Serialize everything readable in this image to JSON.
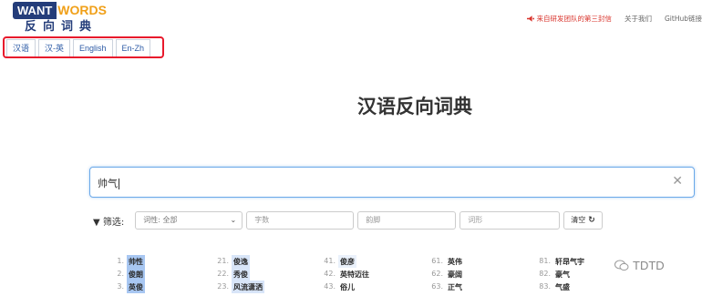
{
  "header": {
    "logo_want": "WANT",
    "logo_words": "WORDS",
    "logo_sub": "反向词典",
    "links": [
      {
        "label": "来自研发团队的第三封信",
        "icon": "megaphone-icon",
        "color": "#d9332b"
      },
      {
        "label": "关于我们"
      },
      {
        "label": "GitHub链接"
      }
    ]
  },
  "tabs": [
    {
      "label": "汉语",
      "active": true
    },
    {
      "label": "汉-英"
    },
    {
      "label": "English"
    },
    {
      "label": "En-Zh"
    }
  ],
  "page_title": "汉语反向词典",
  "search": {
    "value": "帅气",
    "clear_icon": "close-icon"
  },
  "filter": {
    "label": "▼ 筛选:",
    "pos_select": "词性: 全部",
    "char_count_placeholder": "字数",
    "rhyme_placeholder": "韵脚",
    "form_placeholder": "词形",
    "clear_label": "清空",
    "clear_icon": "refresh-icon"
  },
  "results": [
    [
      {
        "n": "1.",
        "w": "帅性"
      },
      {
        "n": "2.",
        "w": "俊朗"
      },
      {
        "n": "3.",
        "w": "英俊"
      }
    ],
    [
      {
        "n": "21.",
        "w": "俊逸"
      },
      {
        "n": "22.",
        "w": "秀俊"
      },
      {
        "n": "23.",
        "w": "风流潇洒"
      }
    ],
    [
      {
        "n": "41.",
        "w": "俊彦"
      },
      {
        "n": "42.",
        "w": "英特迈往"
      },
      {
        "n": "43.",
        "w": "俗儿"
      }
    ],
    [
      {
        "n": "61.",
        "w": "英伟"
      },
      {
        "n": "62.",
        "w": "豪阔"
      },
      {
        "n": "63.",
        "w": "正气"
      }
    ],
    [
      {
        "n": "81.",
        "w": "轩昂气宇"
      },
      {
        "n": "82.",
        "w": "豪气"
      },
      {
        "n": "83.",
        "w": "气盛"
      }
    ]
  ],
  "watermark": "TDTD",
  "colors": {
    "brand_dark": "#243d7a",
    "brand_orange": "#f0a019",
    "highlight_box": "#e8192c",
    "link_blue": "#2d5ba6"
  }
}
